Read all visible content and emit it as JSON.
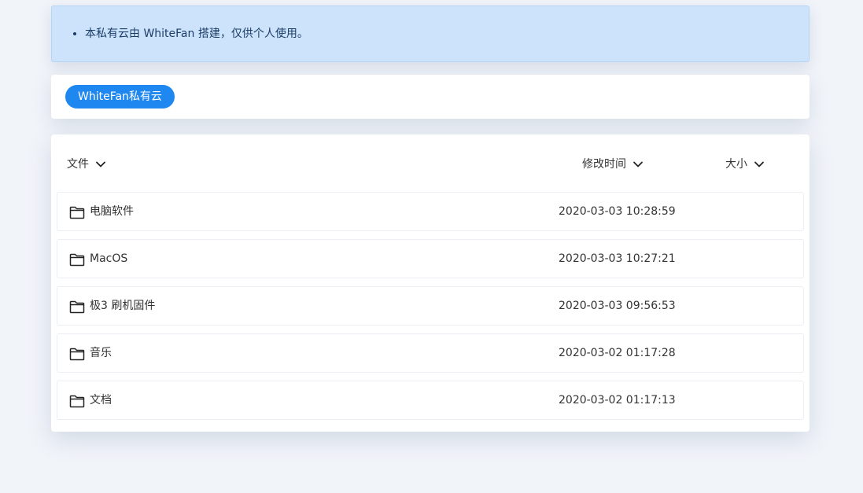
{
  "notice": {
    "text": "本私有云由 WhiteFan 搭建，仅供个人使用。"
  },
  "breadcrumb": {
    "root_label": "WhiteFan私有云"
  },
  "table": {
    "headers": {
      "name": "文件",
      "modified": "修改时间",
      "size": "大小"
    },
    "rows": [
      {
        "name": "电脑软件",
        "modified": "2020-03-03 10:28:59",
        "size": ""
      },
      {
        "name": "MacOS",
        "modified": "2020-03-03 10:27:21",
        "size": ""
      },
      {
        "name": "极3 刷机固件",
        "modified": "2020-03-03 09:56:53",
        "size": ""
      },
      {
        "name": "音乐",
        "modified": "2020-03-02 01:17:28",
        "size": ""
      },
      {
        "name": "文档",
        "modified": "2020-03-02 01:17:13",
        "size": ""
      }
    ]
  },
  "icons": {
    "folder": "folder-icon",
    "sort": "chevron-down-icon"
  },
  "colors": {
    "accent": "#1f87f0",
    "notice_bg": "#cce3fb",
    "page_bg": "#f1f4f9"
  }
}
